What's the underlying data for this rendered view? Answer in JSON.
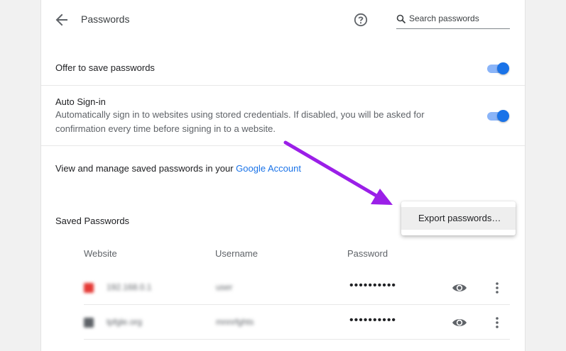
{
  "header": {
    "title": "Passwords",
    "search_placeholder": "Search passwords",
    "back_icon": "arrow-back-icon",
    "help_icon": "help-circle-icon"
  },
  "settings": {
    "offer_to_save": {
      "label": "Offer to save passwords",
      "enabled": true
    },
    "auto_signin": {
      "label": "Auto Sign-in",
      "description": "Automatically sign in to websites using stored credentials. If disabled, you will be asked for confirmation every time before signing in to a website.",
      "enabled": true
    },
    "manage": {
      "prefix": "View and manage saved passwords in your ",
      "link": "Google Account"
    }
  },
  "saved_passwords": {
    "title": "Saved Passwords",
    "columns": {
      "website": "Website",
      "username": "Username",
      "password": "Password"
    },
    "rows": [
      {
        "site": "192.168.0.1",
        "username": "user",
        "password": "••••••••••",
        "favicon_color": "#e53935"
      },
      {
        "site": "tpfgle.org",
        "username": "mnnrfghts",
        "password": "••••••••••",
        "favicon_color": "#5f6368"
      }
    ]
  },
  "menu": {
    "export_label": "Export passwords…"
  },
  "colors": {
    "accent": "#1a73e8",
    "toggle_track": "#8ab4f8",
    "annotation_arrow": "#9b1fe8"
  }
}
